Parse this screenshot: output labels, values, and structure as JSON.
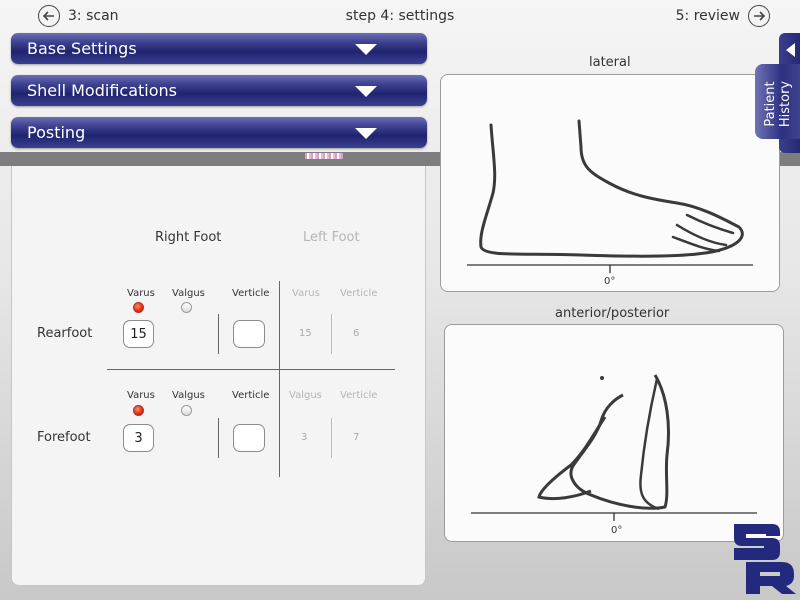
{
  "nav": {
    "back_label": "3: scan",
    "title": "step 4: settings",
    "next_label": "5: review"
  },
  "sections": {
    "base_settings": "Base Settings",
    "shell_modifications": "Shell Modifications",
    "posting": "Posting"
  },
  "posting": {
    "right_foot": "Right Foot",
    "left_foot": "Left Foot",
    "rearfoot": {
      "label": "Rearfoot",
      "right_col1": "Varus",
      "right_col2": "Valgus",
      "right_col3": "Verticle",
      "selected": "Varus",
      "right_value": "15",
      "right_vertical_value": "",
      "left_col1": "Varus",
      "left_col2": "Verticle",
      "left_value": "15",
      "left_vertical_value": "6"
    },
    "forefoot": {
      "label": "Forefoot",
      "right_col1": "Varus",
      "right_col2": "Valgus",
      "right_col3": "Verticle",
      "selected": "Varus",
      "right_value": "3",
      "right_vertical_value": "",
      "left_col1": "Valgus",
      "left_col2": "Verticle",
      "left_value": "3",
      "left_vertical_value": "7"
    }
  },
  "views": {
    "lateral": {
      "title": "lateral",
      "axis": "0°"
    },
    "anterior_posterior": {
      "title": "anterior/posterior",
      "axis": "0°"
    }
  },
  "patient_history": {
    "line1": "Patient",
    "line2": "History"
  },
  "logo": {
    "letters": "SR",
    "icon": "sr-logo"
  },
  "colors": {
    "accent_bar": "#2b2f7a",
    "radio_selected": "#e0341a",
    "background": "#e7e7e7"
  }
}
